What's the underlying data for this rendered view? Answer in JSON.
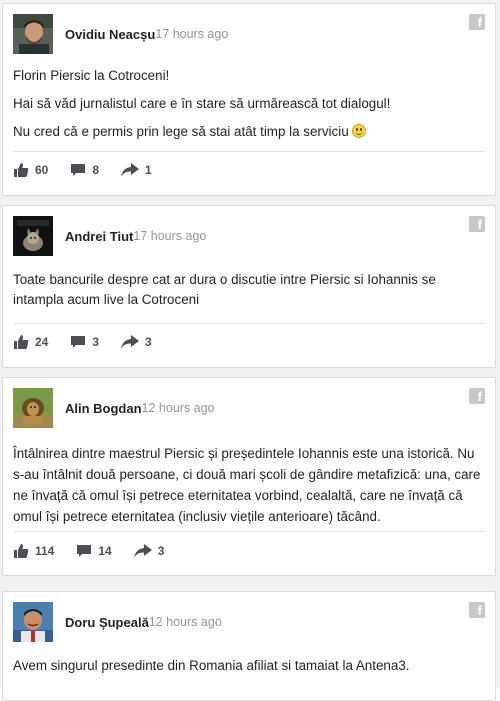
{
  "posts": [
    {
      "author": "Ovidiu Neacșu",
      "time": "17 hours ago",
      "lines": [
        "Florin Piersic la Cotroceni!",
        "Hai să văd jurnalistul care e în stare să urmărească tot dialogul!",
        "Nu cred că e permis prin lege să stai atât timp la serviciu"
      ],
      "likes": "60",
      "comments": "8",
      "shares": "1"
    },
    {
      "author": "Andrei Tiut",
      "time": "17 hours ago",
      "lines": [
        "Toate bancurile despre cat ar dura o discutie intre Piersic si Iohannis se intampla acum live la Cotroceni"
      ],
      "likes": "24",
      "comments": "3",
      "shares": "3"
    },
    {
      "author": "Alin Bogdan",
      "time": "12 hours ago",
      "lines": [
        "Întâlnirea dintre maestrul Piersic și președintele Iohannis este una istorică. Nu s-au întâlnit două persoane, ci două mari școli de gândire metafizică: una, care ne învață că omul își petrece eternitatea vorbind, cealaltă, care ne învață că omul își petrece eternitatea (inclusiv viețile anterioare) tăcând."
      ],
      "likes": "114",
      "comments": "14",
      "shares": "3"
    },
    {
      "author": "Doru Șupeală",
      "time": "12 hours ago",
      "lines": [
        "Avem singurul presedinte din Romania afiliat si tamaiat la Antena3."
      ]
    }
  ],
  "icons": {
    "facebook": "facebook-icon",
    "like": "thumbs-up-icon",
    "comment": "comment-bubble-icon",
    "share": "share-arrow-icon",
    "emoji": "smiley-emoji"
  },
  "colors": {
    "text": "#1d2129",
    "muted": "#90949c",
    "icon": "#4b4f56",
    "border": "#d9dadc"
  }
}
